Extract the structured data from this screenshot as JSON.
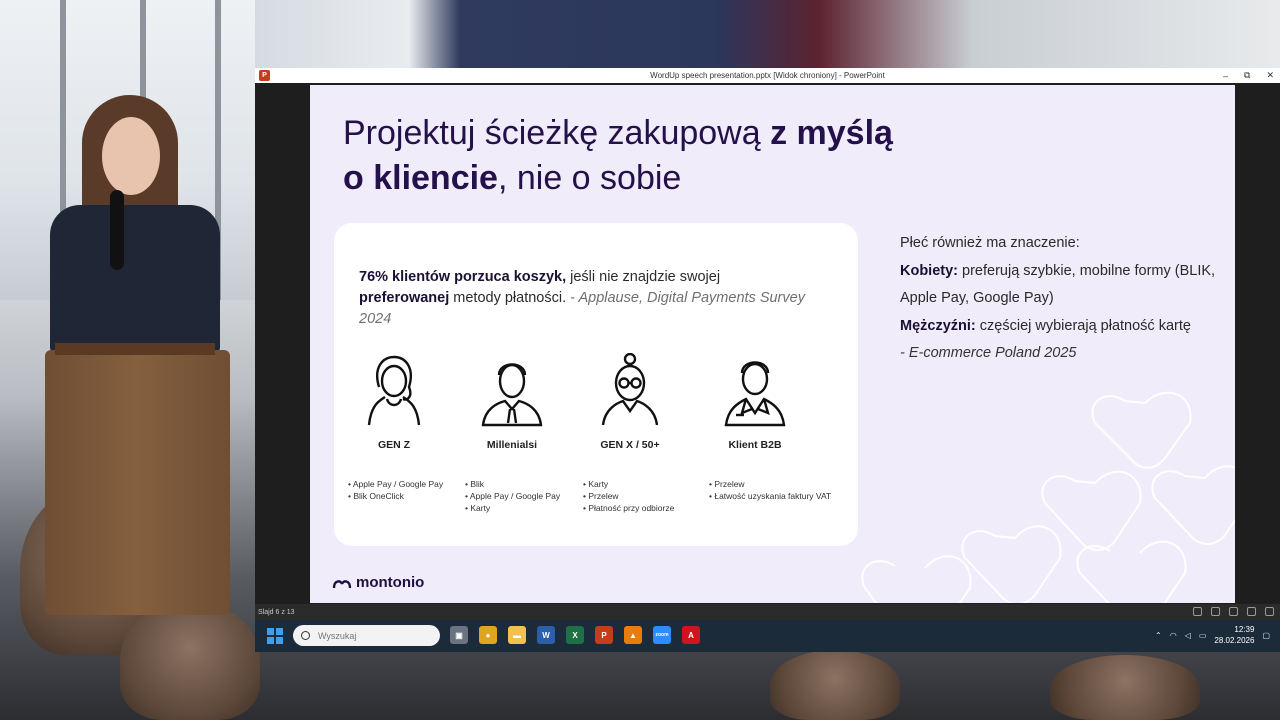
{
  "window": {
    "title": "WordUp speech presentation.pptx [Widok chroniony] - PowerPoint",
    "controls": [
      "–",
      "⧉",
      "✕"
    ]
  },
  "slide": {
    "title_part1": "Projektuj ścieżkę zakupową ",
    "title_bold1": "z myślą",
    "title_bold2": "o kliencie",
    "title_part2": ", nie o sobie",
    "stat_bold1": "76% klientów porzuca koszyk,",
    "stat_text1": " jeśli nie znajdzie swojej ",
    "stat_bold2": "preferowanej",
    "stat_text2": " metody płatności. ",
    "stat_source": "- Applause, Digital Payments Survey 2024",
    "personas": [
      {
        "name": "GEN Z",
        "icon": "woman-avatar-icon",
        "bullets": [
          "Apple Pay / Google Pay",
          "Blik OneClick"
        ]
      },
      {
        "name": "Millenialsi",
        "icon": "man-tie-avatar-icon",
        "bullets": [
          "Blik",
          "Apple Pay / Google Pay",
          "Karty"
        ]
      },
      {
        "name": "GEN X / 50+",
        "icon": "woman-glasses-avatar-icon",
        "bullets": [
          "Karty",
          "Przelew",
          "Płatność przy odbiorze"
        ]
      },
      {
        "name": "Klient B2B",
        "icon": "businessman-avatar-icon",
        "bullets": [
          "Przelew",
          "Łatwość uzyskania faktury VAT"
        ]
      }
    ],
    "side_intro": "Płeć również ma znaczenie:",
    "side_women_label": "Kobiety:",
    "side_women_text": " preferują szybkie, mobilne formy (BLIK, Apple Pay, Google Pay)",
    "side_men_label": "Mężczyźni:",
    "side_men_text": " częściej wybierają płatność kartę",
    "side_source": "- E-commerce Poland 2025",
    "logo": "montonio"
  },
  "statusbar": {
    "slide_counter": "Slajd 6 z 13"
  },
  "taskbar": {
    "search_placeholder": "Wyszukaj",
    "apps": [
      {
        "name": "task-view",
        "label": "▣",
        "color": "#6b7380"
      },
      {
        "name": "chrome",
        "label": "●",
        "color": "#e0a420"
      },
      {
        "name": "file-explorer",
        "label": "▬",
        "color": "#f2c14e"
      },
      {
        "name": "word",
        "label": "W",
        "color": "#2b5faa"
      },
      {
        "name": "excel",
        "label": "X",
        "color": "#1e7145"
      },
      {
        "name": "powerpoint",
        "label": "P",
        "color": "#c43e1c"
      },
      {
        "name": "vlc",
        "label": "▲",
        "color": "#e87d0d"
      },
      {
        "name": "zoom",
        "label": "zoom",
        "color": "#2d8cff"
      },
      {
        "name": "acrobat",
        "label": "A",
        "color": "#d0141b"
      }
    ],
    "time": "12:39",
    "date": "28.02.2026"
  }
}
